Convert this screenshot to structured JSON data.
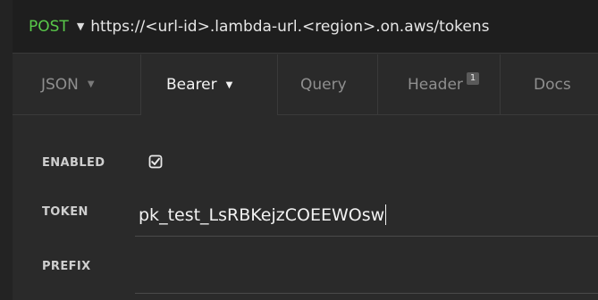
{
  "request": {
    "method": "POST",
    "url": "https://<url-id>.lambda-url.<region>.on.aws/tokens"
  },
  "tabs": [
    {
      "label": "JSON",
      "has_dropdown": true,
      "active": false
    },
    {
      "label": "Bearer",
      "has_dropdown": true,
      "active": true
    },
    {
      "label": "Query",
      "active": false
    },
    {
      "label": "Header",
      "badge": "1",
      "active": false
    },
    {
      "label": "Docs",
      "active": false
    }
  ],
  "auth": {
    "enabled_label": "ENABLED",
    "enabled": true,
    "token_label": "TOKEN",
    "token_value": "pk_test_LsRBKejzCOEEWOsw",
    "prefix_label": "PREFIX",
    "prefix_value": ""
  },
  "colors": {
    "method": "#59c94a",
    "background": "#2a2a2a",
    "url_bar": "#1e1e1e",
    "text": "#e6e6e6"
  },
  "icons": {
    "method_dropdown": "caret-down-icon",
    "tab_dropdown": "caret-down-icon",
    "checkbox": "checkbox-checked-icon"
  }
}
